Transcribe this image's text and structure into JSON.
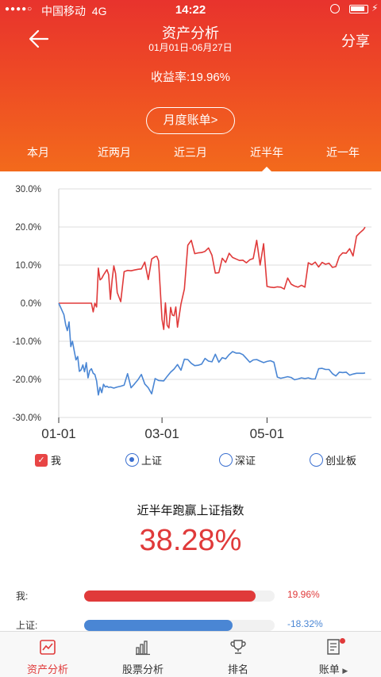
{
  "status_bar": {
    "carrier": "中国移动",
    "network": "4G",
    "time": "14:22",
    "icons": [
      "signal-dots",
      "rotation-lock-icon",
      "battery-icon",
      "charging-icon"
    ]
  },
  "nav": {
    "title": "资产分析",
    "subtitle": "01月01日-06月27日",
    "share_label": "分享",
    "back_icon": "arrow-left-icon"
  },
  "summary": {
    "yield_label": "收益率:",
    "yield_value": "19.96%",
    "monthly_bill_label": "月度账单>"
  },
  "period_tabs": [
    {
      "label": "本月",
      "active": false
    },
    {
      "label": "近两月",
      "active": false
    },
    {
      "label": "近三月",
      "active": false
    },
    {
      "label": "近半年",
      "active": true
    },
    {
      "label": "近一年",
      "active": false
    }
  ],
  "chart_data": {
    "type": "line",
    "y_ticks": [
      "30.0%",
      "20.0%",
      "10.0%",
      "0.0%",
      "-10.0%",
      "-20.0%",
      "-30.0%"
    ],
    "x_ticks": [
      "01-01",
      "03-01",
      "05-01"
    ],
    "ylim": [
      -30,
      30
    ],
    "x_range": [
      "01-01",
      "06-27"
    ],
    "grid": true,
    "colors": {
      "mine": "#e03a3a",
      "shanghai": "#4a86d4"
    },
    "series": [
      {
        "name": "我",
        "x": [
          "01-01",
          "01-08",
          "01-09",
          "01-10",
          "01-11",
          "01-12",
          "01-13",
          "01-14",
          "01-15",
          "01-16",
          "01-17",
          "01-18",
          "01-19",
          "01-20",
          "01-21",
          "01-22",
          "01-23",
          "01-24",
          "01-25",
          "01-26",
          "01-27",
          "01-28",
          "01-29",
          "01-30",
          "01-31",
          "02-01",
          "02-02",
          "02-03",
          "02-04",
          "02-06",
          "02-08",
          "02-10",
          "02-12",
          "02-14",
          "02-16",
          "02-18",
          "02-20",
          "02-22",
          "02-24",
          "02-26",
          "02-27",
          "02-28",
          "03-01",
          "03-02",
          "03-03",
          "03-04",
          "03-05",
          "03-06",
          "03-07",
          "03-08",
          "03-09",
          "03-10",
          "03-12",
          "03-14",
          "03-16",
          "03-18",
          "03-20",
          "03-22",
          "03-24",
          "03-26",
          "03-28",
          "03-30",
          "04-01",
          "04-03",
          "04-05",
          "04-07",
          "04-09",
          "04-11",
          "04-13",
          "04-15",
          "04-17",
          "04-19",
          "04-21",
          "04-23",
          "04-25",
          "04-27",
          "04-29",
          "05-01",
          "05-03",
          "05-05",
          "05-07",
          "05-09",
          "05-11",
          "05-13",
          "05-15",
          "05-17",
          "05-19",
          "05-21",
          "05-23",
          "05-25",
          "05-27",
          "05-29",
          "05-31",
          "06-02",
          "06-04",
          "06-06",
          "06-08",
          "06-10",
          "06-12",
          "06-14",
          "06-16",
          "06-18",
          "06-20",
          "06-22",
          "06-24",
          "06-26",
          "06-27"
        ],
        "values": [
          0,
          0,
          0,
          0,
          0,
          0,
          0,
          0,
          0,
          0,
          0,
          0,
          0,
          0,
          -2.3,
          0,
          -1,
          9.2,
          6.1,
          6.5,
          7.4,
          8.1,
          8.8,
          7.5,
          1,
          6,
          9.8,
          7.8,
          2.8,
          0.4,
          8.3,
          8.6,
          8.5,
          8.7,
          8.9,
          9,
          10.8,
          6.2,
          11.6,
          12.2,
          12.3,
          11.1,
          -4.2,
          -6.9,
          0.1,
          -5.8,
          -6.5,
          -1.1,
          -3.1,
          -3.3,
          -1,
          -6.3,
          -0.2,
          3.7,
          15.2,
          16.5,
          13,
          13.2,
          13.3,
          13.6,
          14.5,
          12.6,
          7.9,
          8,
          11.8,
          10.7,
          13.1,
          12,
          11.6,
          11.2,
          11.3,
          10.6,
          11.4,
          11.7,
          16.5,
          10,
          15.6,
          4.4,
          4.2,
          4.1,
          4.3,
          4.2,
          3.7,
          6.6,
          5,
          4.5,
          4.2,
          4.7,
          4.2,
          10.6,
          10.1,
          10.8,
          9.5,
          10.7,
          10.2,
          10.5,
          9.4,
          9.6,
          12.3,
          13.2,
          13.1,
          14.3,
          12.4,
          17.6,
          18.5,
          19.3,
          19.96
        ]
      },
      {
        "name": "上证",
        "x": [
          "01-01",
          "01-04",
          "01-05",
          "01-06",
          "01-07",
          "01-08",
          "01-09",
          "01-10",
          "01-11",
          "01-12",
          "01-13",
          "01-14",
          "01-15",
          "01-16",
          "01-17",
          "01-18",
          "01-19",
          "01-20",
          "01-21",
          "01-22",
          "01-23",
          "01-24",
          "01-25",
          "01-26",
          "01-27",
          "01-28",
          "01-29",
          "01-30",
          "01-31",
          "02-02",
          "02-04",
          "02-06",
          "02-08",
          "02-10",
          "02-12",
          "02-14",
          "02-16",
          "02-18",
          "02-20",
          "02-22",
          "02-24",
          "02-26",
          "02-28",
          "03-02",
          "03-04",
          "03-06",
          "03-08",
          "03-10",
          "03-12",
          "03-14",
          "03-16",
          "03-18",
          "03-20",
          "03-22",
          "03-24",
          "03-26",
          "03-28",
          "03-30",
          "04-01",
          "04-03",
          "04-05",
          "04-07",
          "04-09",
          "04-11",
          "04-13",
          "04-15",
          "04-17",
          "04-19",
          "04-21",
          "04-23",
          "04-25",
          "04-27",
          "04-29",
          "05-01",
          "05-03",
          "05-05",
          "05-07",
          "05-09",
          "05-11",
          "05-13",
          "05-15",
          "05-17",
          "05-19",
          "05-21",
          "05-23",
          "05-25",
          "05-27",
          "05-29",
          "05-31",
          "06-02",
          "06-04",
          "06-06",
          "06-08",
          "06-10",
          "06-12",
          "06-14",
          "06-16",
          "06-18",
          "06-20",
          "06-22",
          "06-24",
          "06-26",
          "06-27"
        ],
        "values": [
          0,
          -3,
          -5.6,
          -7.2,
          -4.9,
          -11.4,
          -10,
          -12.5,
          -14.9,
          -14,
          -17.9,
          -17.5,
          -16.2,
          -18,
          -15.6,
          -19.6,
          -17.7,
          -17.2,
          -18.4,
          -18.7,
          -20.4,
          -24.1,
          -22.1,
          -23.5,
          -21.3,
          -22,
          -21.8,
          -22.1,
          -22,
          -22.3,
          -22,
          -21.8,
          -21.5,
          -18.5,
          -22.2,
          -21.2,
          -20.1,
          -18.7,
          -21.2,
          -22.2,
          -23.8,
          -19.8,
          -20.3,
          -20.4,
          -19.2,
          -18.1,
          -17.3,
          -16.1,
          -17.6,
          -14.7,
          -14.8,
          -15.8,
          -16.4,
          -16.3,
          -16,
          -14.5,
          -15.2,
          -15.4,
          -13.4,
          -15.5,
          -14.3,
          -14.6,
          -13.5,
          -12.7,
          -13.1,
          -13.1,
          -13.5,
          -14.5,
          -15.5,
          -14.9,
          -14.8,
          -15.2,
          -15.6,
          -15.3,
          -15.1,
          -15.5,
          -19.4,
          -19.7,
          -19.5,
          -19.3,
          -19.5,
          -20.1,
          -19.9,
          -19.6,
          -19.8,
          -19.6,
          -19.9,
          -19.9,
          -17.2,
          -17.1,
          -17.4,
          -17.4,
          -18.5,
          -19.1,
          -18.1,
          -18.2,
          -18.1,
          -18.9,
          -18.6,
          -18.4,
          -18.4,
          -18.4,
          -18.32
        ]
      }
    ]
  },
  "legend": [
    {
      "label": "我",
      "control": "checkbox",
      "checked": true
    },
    {
      "label": "上证",
      "control": "radio",
      "checked": true
    },
    {
      "label": "深证",
      "control": "radio",
      "checked": false
    },
    {
      "label": "创业板",
      "control": "radio",
      "checked": false
    }
  ],
  "beat_index": {
    "title": "近半年跑赢上证指数",
    "value": "38.28%"
  },
  "comparison": [
    {
      "label": "我:",
      "value_text": "19.96%",
      "value": 0.9,
      "color": "#e03a3a"
    },
    {
      "label": "上证:",
      "value_text": "-18.32%",
      "value": 0.78,
      "color": "#4a86d4"
    }
  ],
  "bottom_nav": [
    {
      "label": "资产分析",
      "icon": "asset-analysis-icon",
      "active": true
    },
    {
      "label": "股票分析",
      "icon": "bar-chart-icon",
      "active": false
    },
    {
      "label": "排名",
      "icon": "trophy-icon",
      "active": false
    },
    {
      "label": "账单",
      "icon": "bill-icon",
      "active": false,
      "badge": true
    }
  ]
}
